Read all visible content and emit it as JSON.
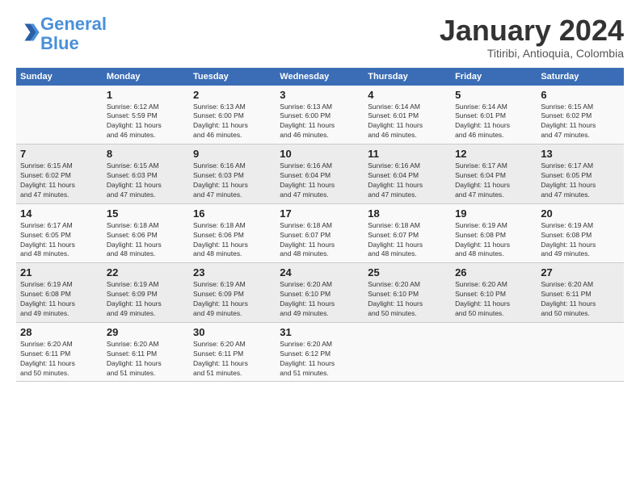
{
  "header": {
    "logo_line1": "General",
    "logo_line2": "Blue",
    "month_title": "January 2024",
    "subtitle": "Titiribi, Antioquia, Colombia"
  },
  "calendar": {
    "days_of_week": [
      "Sunday",
      "Monday",
      "Tuesday",
      "Wednesday",
      "Thursday",
      "Friday",
      "Saturday"
    ],
    "weeks": [
      [
        {
          "day": "",
          "info": ""
        },
        {
          "day": "1",
          "info": "Sunrise: 6:12 AM\nSunset: 5:59 PM\nDaylight: 11 hours\nand 46 minutes."
        },
        {
          "day": "2",
          "info": "Sunrise: 6:13 AM\nSunset: 6:00 PM\nDaylight: 11 hours\nand 46 minutes."
        },
        {
          "day": "3",
          "info": "Sunrise: 6:13 AM\nSunset: 6:00 PM\nDaylight: 11 hours\nand 46 minutes."
        },
        {
          "day": "4",
          "info": "Sunrise: 6:14 AM\nSunset: 6:01 PM\nDaylight: 11 hours\nand 46 minutes."
        },
        {
          "day": "5",
          "info": "Sunrise: 6:14 AM\nSunset: 6:01 PM\nDaylight: 11 hours\nand 46 minutes."
        },
        {
          "day": "6",
          "info": "Sunrise: 6:15 AM\nSunset: 6:02 PM\nDaylight: 11 hours\nand 47 minutes."
        }
      ],
      [
        {
          "day": "7",
          "info": "Sunrise: 6:15 AM\nSunset: 6:02 PM\nDaylight: 11 hours\nand 47 minutes."
        },
        {
          "day": "8",
          "info": "Sunrise: 6:15 AM\nSunset: 6:03 PM\nDaylight: 11 hours\nand 47 minutes."
        },
        {
          "day": "9",
          "info": "Sunrise: 6:16 AM\nSunset: 6:03 PM\nDaylight: 11 hours\nand 47 minutes."
        },
        {
          "day": "10",
          "info": "Sunrise: 6:16 AM\nSunset: 6:04 PM\nDaylight: 11 hours\nand 47 minutes."
        },
        {
          "day": "11",
          "info": "Sunrise: 6:16 AM\nSunset: 6:04 PM\nDaylight: 11 hours\nand 47 minutes."
        },
        {
          "day": "12",
          "info": "Sunrise: 6:17 AM\nSunset: 6:04 PM\nDaylight: 11 hours\nand 47 minutes."
        },
        {
          "day": "13",
          "info": "Sunrise: 6:17 AM\nSunset: 6:05 PM\nDaylight: 11 hours\nand 47 minutes."
        }
      ],
      [
        {
          "day": "14",
          "info": "Sunrise: 6:17 AM\nSunset: 6:05 PM\nDaylight: 11 hours\nand 48 minutes."
        },
        {
          "day": "15",
          "info": "Sunrise: 6:18 AM\nSunset: 6:06 PM\nDaylight: 11 hours\nand 48 minutes."
        },
        {
          "day": "16",
          "info": "Sunrise: 6:18 AM\nSunset: 6:06 PM\nDaylight: 11 hours\nand 48 minutes."
        },
        {
          "day": "17",
          "info": "Sunrise: 6:18 AM\nSunset: 6:07 PM\nDaylight: 11 hours\nand 48 minutes."
        },
        {
          "day": "18",
          "info": "Sunrise: 6:18 AM\nSunset: 6:07 PM\nDaylight: 11 hours\nand 48 minutes."
        },
        {
          "day": "19",
          "info": "Sunrise: 6:19 AM\nSunset: 6:08 PM\nDaylight: 11 hours\nand 48 minutes."
        },
        {
          "day": "20",
          "info": "Sunrise: 6:19 AM\nSunset: 6:08 PM\nDaylight: 11 hours\nand 49 minutes."
        }
      ],
      [
        {
          "day": "21",
          "info": "Sunrise: 6:19 AM\nSunset: 6:08 PM\nDaylight: 11 hours\nand 49 minutes."
        },
        {
          "day": "22",
          "info": "Sunrise: 6:19 AM\nSunset: 6:09 PM\nDaylight: 11 hours\nand 49 minutes."
        },
        {
          "day": "23",
          "info": "Sunrise: 6:19 AM\nSunset: 6:09 PM\nDaylight: 11 hours\nand 49 minutes."
        },
        {
          "day": "24",
          "info": "Sunrise: 6:20 AM\nSunset: 6:10 PM\nDaylight: 11 hours\nand 49 minutes."
        },
        {
          "day": "25",
          "info": "Sunrise: 6:20 AM\nSunset: 6:10 PM\nDaylight: 11 hours\nand 50 minutes."
        },
        {
          "day": "26",
          "info": "Sunrise: 6:20 AM\nSunset: 6:10 PM\nDaylight: 11 hours\nand 50 minutes."
        },
        {
          "day": "27",
          "info": "Sunrise: 6:20 AM\nSunset: 6:11 PM\nDaylight: 11 hours\nand 50 minutes."
        }
      ],
      [
        {
          "day": "28",
          "info": "Sunrise: 6:20 AM\nSunset: 6:11 PM\nDaylight: 11 hours\nand 50 minutes."
        },
        {
          "day": "29",
          "info": "Sunrise: 6:20 AM\nSunset: 6:11 PM\nDaylight: 11 hours\nand 51 minutes."
        },
        {
          "day": "30",
          "info": "Sunrise: 6:20 AM\nSunset: 6:11 PM\nDaylight: 11 hours\nand 51 minutes."
        },
        {
          "day": "31",
          "info": "Sunrise: 6:20 AM\nSunset: 6:12 PM\nDaylight: 11 hours\nand 51 minutes."
        },
        {
          "day": "",
          "info": ""
        },
        {
          "day": "",
          "info": ""
        },
        {
          "day": "",
          "info": ""
        }
      ]
    ]
  }
}
